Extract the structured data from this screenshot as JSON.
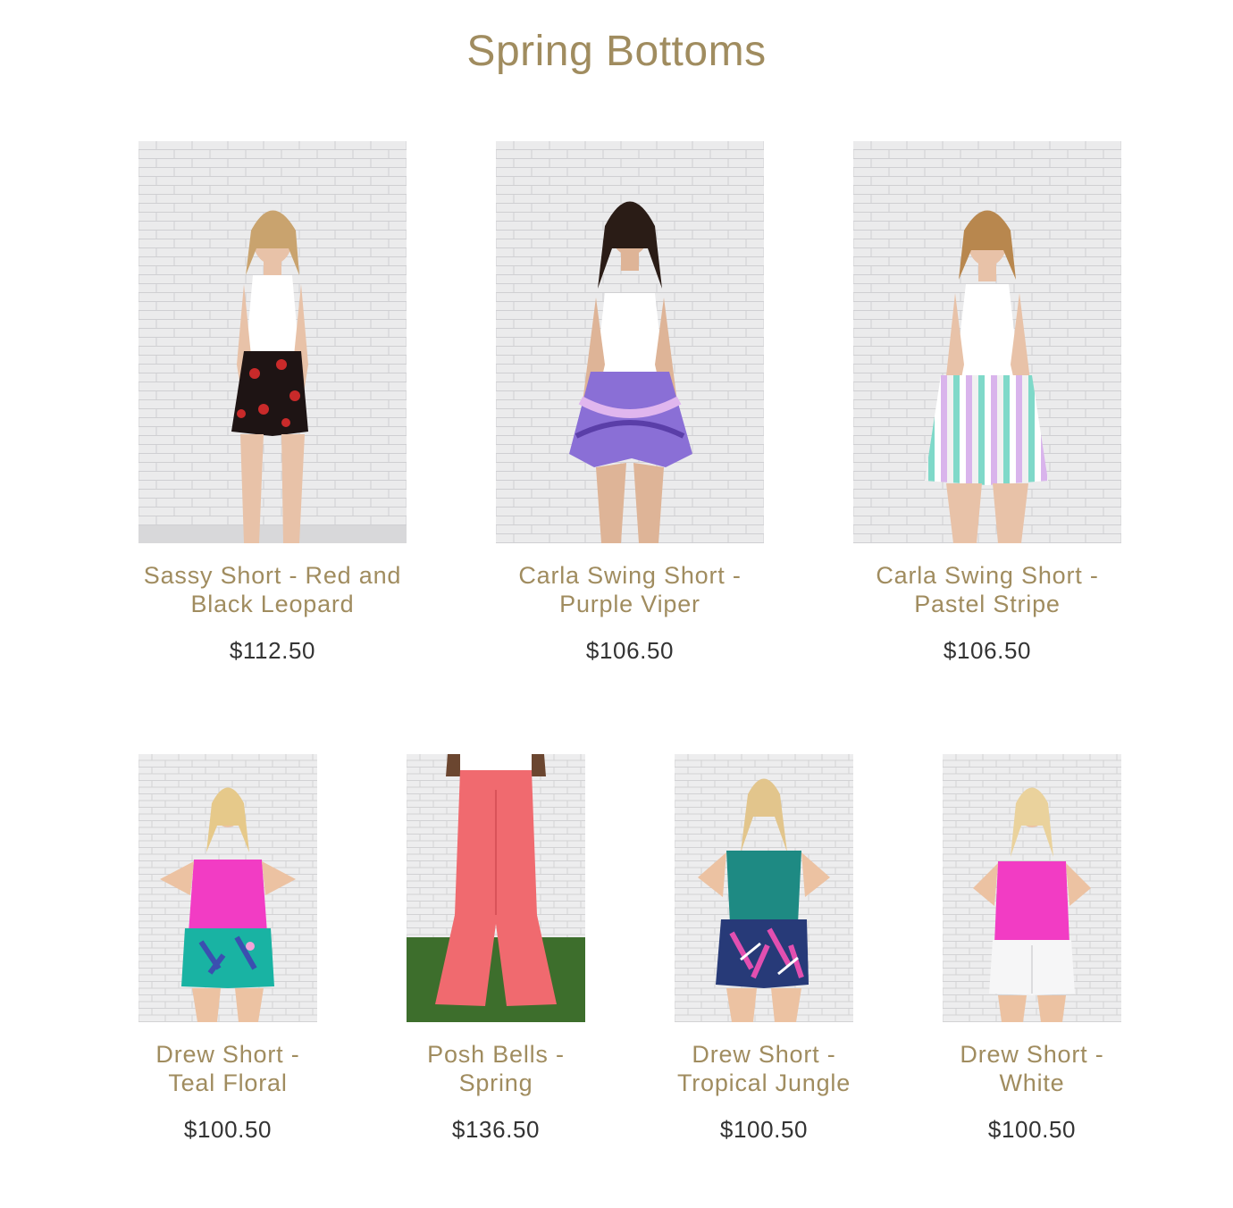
{
  "collection": {
    "title": "Spring Bottoms"
  },
  "products": [
    {
      "name": "Sassy Short - Red and Black Leopard",
      "price": "$112.50",
      "image": "model-photo-red-black-leopard-shorts"
    },
    {
      "name": "Carla Swing Short - Purple Viper",
      "price": "$106.50",
      "image": "model-photo-purple-snake-shorts"
    },
    {
      "name": "Carla Swing Short - Pastel Stripe",
      "price": "$106.50",
      "image": "model-photo-pastel-stripe-shorts"
    },
    {
      "name": "Drew Short - Teal Floral",
      "price": "$100.50",
      "image": "model-photo-teal-floral-shorts"
    },
    {
      "name": "Posh Bells - Spring",
      "price": "$136.50",
      "image": "photo-coral-bell-pants"
    },
    {
      "name": "Drew Short - Tropical Jungle",
      "price": "$100.50",
      "image": "model-photo-tropical-jungle-shorts"
    },
    {
      "name": "Drew Short - White",
      "price": "$100.50",
      "image": "model-photo-white-shorts"
    }
  ],
  "colors": {
    "accent": "#a08c5f",
    "price": "#333333",
    "background": "#ffffff"
  }
}
